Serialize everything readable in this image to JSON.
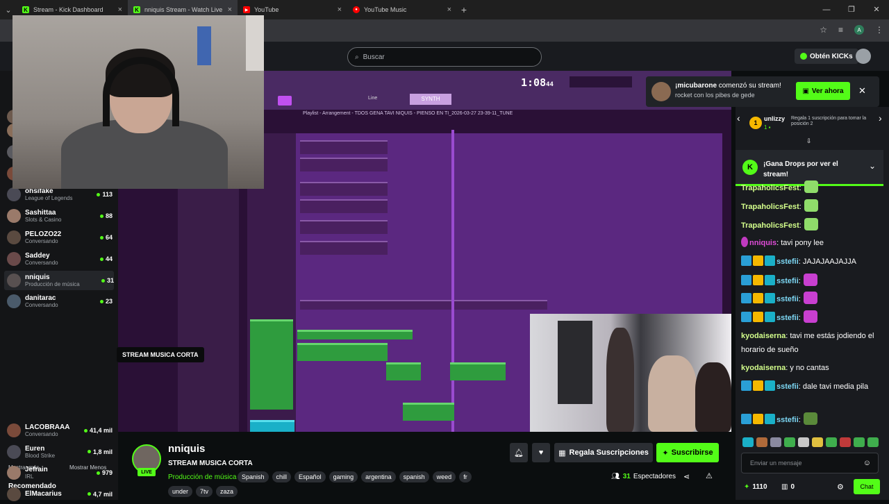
{
  "browser": {
    "tabs": [
      {
        "label": "Stream - Kick Dashboard",
        "favicon": "K",
        "color": "#53fc18"
      },
      {
        "label": "nniquis Stream - Watch Live on",
        "favicon": "K",
        "color": "#53fc18"
      },
      {
        "label": "YouTube",
        "favicon": "▶",
        "color": "#ff0000"
      },
      {
        "label": "YouTube Music",
        "favicon": "●",
        "color": "#ff0000"
      }
    ],
    "profile_initial": "A"
  },
  "header": {
    "search_placeholder": "Buscar",
    "kicks_label": "Obtén KICKs"
  },
  "sidebar": {
    "following": [
      {
        "name": "",
        "category": "Conversando",
        "count": ""
      },
      {
        "name": "mazzatomas",
        "category": "Chat Roulette",
        "count": "913"
      },
      {
        "name": "Vector",
        "category": "World War Z",
        "count": "786"
      },
      {
        "name": "ElcanaldeJoaco",
        "category": "Conversando",
        "count": "192"
      },
      {
        "name": "ohsifake",
        "category": "League of Legends",
        "count": "113"
      },
      {
        "name": "Sashittaa",
        "category": "Slots & Casino",
        "count": "88"
      },
      {
        "name": "PELOZO22",
        "category": "Conversando",
        "count": "64"
      },
      {
        "name": "Saddey",
        "category": "Conversando",
        "count": "44"
      },
      {
        "name": "nniquis",
        "category": "Producción de música",
        "count": "31"
      },
      {
        "name": "danitarac",
        "category": "Conversando",
        "count": "23"
      }
    ],
    "show_more": "Mostrar más",
    "show_less": "Mostrar Menos",
    "recommended_heading": "Recomendado",
    "recommended": [
      {
        "name": "LACOBRAAA",
        "category": "Conversando",
        "count": "41,4 mil"
      },
      {
        "name": "Euren",
        "category": "Blood Strike",
        "count": "1,8 mil"
      },
      {
        "name": "Jefrain",
        "category": "IRL",
        "count": "979"
      },
      {
        "name": "ElMacarius",
        "category": "",
        "count": "4,7 mil"
      }
    ],
    "tooltip": "STREAM MUSICA CORTA"
  },
  "video": {
    "daw_time": "1:08",
    "daw_time_small": "44",
    "daw_title": "Playlist - Arrangement - TDOS GENA TAVI NIQUIS - PIENSO EN TI_2026-03-27 23-39-11_TUNE",
    "daw_pattern": "SYNTH",
    "daw_mode": "Line"
  },
  "notification": {
    "user": "¡micubarone",
    "action": " comenzó su stream!",
    "subtitle": "rocket con los pibes de gede",
    "button": "Ver ahora"
  },
  "chat": {
    "top_gifter": {
      "rank": "1",
      "user": "unlizzy",
      "count": "1",
      "desc": "Regala 1 suscripción para tomar la posición 2"
    },
    "drops": "¡Gana Drops por ver el stream!",
    "messages": [
      {
        "user": "TrapaholicsFest",
        "text": "",
        "color": "#d4ff8c",
        "badges": 0,
        "emote": "#8fdc6a"
      },
      {
        "user": "TrapaholicsFest",
        "text": "",
        "color": "#d4ff8c",
        "badges": 0,
        "emote": "#8fdc6a"
      },
      {
        "user": "TrapaholicsFest",
        "text": "",
        "color": "#d4ff8c",
        "badges": 0,
        "emote": "#8fdc6a"
      },
      {
        "user": "nniquis",
        "text": " tavi pony lee",
        "color": "#e04cd8",
        "badges": 0,
        "emote": ""
      },
      {
        "user": "sstefii",
        "text": " JAJAJAAJAJJA",
        "color": "#7dd8f5",
        "badges": 3,
        "emote": ""
      },
      {
        "user": "sstefii",
        "text": "",
        "color": "#7dd8f5",
        "badges": 3,
        "emote": "#c83fd0"
      },
      {
        "user": "sstefii",
        "text": "",
        "color": "#7dd8f5",
        "badges": 3,
        "emote": "#c83fd0"
      },
      {
        "user": "sstefii",
        "text": "",
        "color": "#7dd8f5",
        "badges": 3,
        "emote": "#c83fd0"
      },
      {
        "user": "kyodaiserna",
        "text": " tavi me estás jodiendo el horario de sueño",
        "color": "#d4ff8c",
        "badges": 0,
        "emote": ""
      },
      {
        "user": "kyodaiserna",
        "text": " y no cantas",
        "color": "#d4ff8c",
        "badges": 0,
        "emote": ""
      },
      {
        "user": "sstefii",
        "text": " dale tavi media pila",
        "color": "#7dd8f5",
        "badges": 3,
        "emote": ""
      },
      {
        "user": "sstefii",
        "text": "",
        "color": "#7dd8f5",
        "badges": 3,
        "emote": "#5a8a3a"
      }
    ],
    "input_placeholder": "Enviar un mensaje",
    "kicks_count": "1110",
    "other_count": "0",
    "chat_button": "Chat"
  },
  "stream": {
    "channel": "nniquis",
    "live_label": "LIVE",
    "title": "STREAM MUSICA CORTA",
    "category": "Producción de música",
    "tags": [
      "Spanish",
      "chill",
      "Español",
      "gaming",
      "argentina",
      "spanish",
      "weed",
      "fr"
    ],
    "tags_row2": [
      "under",
      "7tv",
      "zaza"
    ],
    "gift_label": "Regala Suscripciones",
    "subscribe_label": "Suscribirse",
    "viewers": "31",
    "viewers_label": "Espectadores"
  },
  "colors": {
    "accent": "#53fc18",
    "bg": "#0b0e0f",
    "panel": "#191b1f"
  }
}
